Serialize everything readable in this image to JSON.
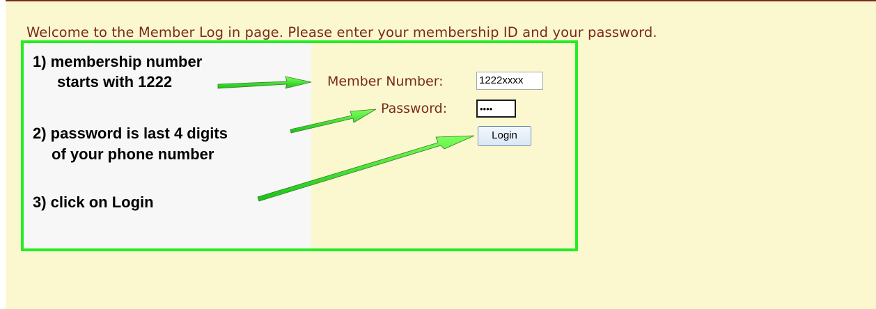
{
  "page": {
    "welcome_text": "Welcome to the Member Log in page. Please enter your membership ID and your password."
  },
  "instructions": {
    "step1_line1": "1) membership number",
    "step1_line2": "starts with 1222",
    "step2_line1": "2) password is last 4 digits",
    "step2_line2": "of your phone number",
    "step3": "3) click on Login"
  },
  "form": {
    "member_number_label": "Member Number:",
    "member_number_value": "1222xxxx",
    "password_label": "Password:",
    "password_value": "••••",
    "login_label": "Login"
  },
  "colors": {
    "page_background": "#fbf8cf",
    "label_text": "#7a2a1a",
    "highlight": "#22ee22"
  }
}
